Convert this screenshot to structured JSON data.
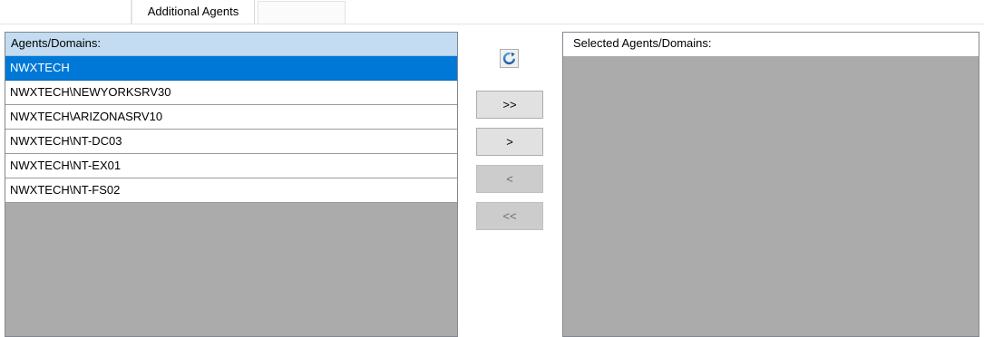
{
  "tabs": {
    "active_label": "Additional Agents"
  },
  "left_list": {
    "header": "Agents/Domains:",
    "items": [
      {
        "label": "NWXTECH",
        "selected": true
      },
      {
        "label": "NWXTECH\\NEWYORKSRV30",
        "selected": false
      },
      {
        "label": "NWXTECH\\ARIZONASRV10",
        "selected": false
      },
      {
        "label": "NWXTECH\\NT-DC03",
        "selected": false
      },
      {
        "label": "NWXTECH\\NT-EX01",
        "selected": false
      },
      {
        "label": "NWXTECH\\NT-FS02",
        "selected": false
      }
    ]
  },
  "right_list": {
    "header": "Selected Agents/Domains:",
    "items": []
  },
  "controls": {
    "refresh_icon": "refresh-icon",
    "add_all_label": ">>",
    "add_label": ">",
    "remove_label": "<",
    "remove_all_label": "<<"
  },
  "colors": {
    "selection": "#0078d7",
    "header_left": "#c3dcf1",
    "list_empty_area": "#ababab"
  }
}
